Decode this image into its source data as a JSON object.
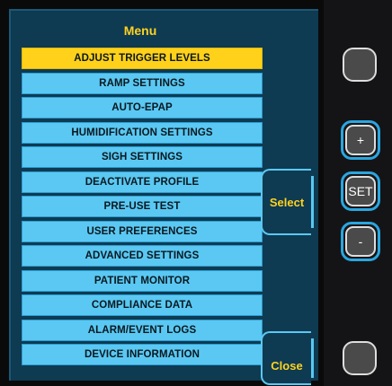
{
  "menu": {
    "title": "Menu",
    "items": [
      {
        "label": "ADJUST TRIGGER LEVELS",
        "selected": true
      },
      {
        "label": "RAMP SETTINGS",
        "selected": false
      },
      {
        "label": "AUTO-EPAP",
        "selected": false
      },
      {
        "label": "HUMIDIFICATION SETTINGS",
        "selected": false
      },
      {
        "label": "SIGH SETTINGS",
        "selected": false
      },
      {
        "label": "DEACTIVATE PROFILE",
        "selected": false
      },
      {
        "label": "PRE-USE TEST",
        "selected": false
      },
      {
        "label": "USER PREFERENCES",
        "selected": false
      },
      {
        "label": "ADVANCED SETTINGS",
        "selected": false
      },
      {
        "label": "PATIENT MONITOR",
        "selected": false
      },
      {
        "label": "COMPLIANCE DATA",
        "selected": false
      },
      {
        "label": "ALARM/EVENT LOGS",
        "selected": false
      },
      {
        "label": "DEVICE INFORMATION",
        "selected": false
      }
    ]
  },
  "softkeys": {
    "select_label": "Select",
    "close_label": "Close"
  },
  "hardware": {
    "plus_label": "+",
    "set_label": "SET",
    "minus_label": "-"
  },
  "colors": {
    "screen_bg": "#0e3a52",
    "item_bg": "#5ac8f2",
    "selected_bg": "#ffd11a",
    "title": "#ffd21f",
    "accent_ring": "#2aa6e0"
  }
}
